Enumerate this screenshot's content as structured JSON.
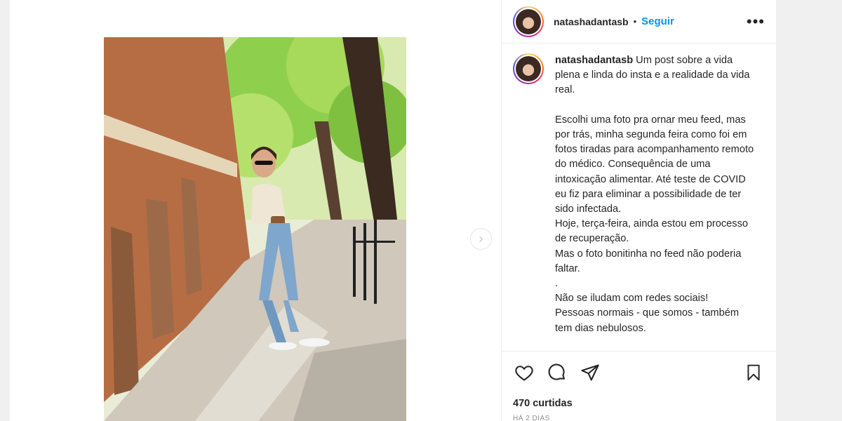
{
  "post": {
    "username": "natashadantasb",
    "separator": "•",
    "follow_label": "Seguir",
    "more_icon": "more-options-icon",
    "caption": "Um post sobre a vida plena e linda do insta e a realidade da vida real.\n\nEscolhi uma foto pra ornar meu feed, mas por trás, minha segunda feira como foi em fotos tiradas para acompanhamento remoto do médico. Consequência de uma intoxicação alimentar. Até teste de COVID eu fiz para eliminar a possibilidade de ter sido infectada.\nHoje, terça-feira, ainda estou em processo de recuperação.\nMas o foto bonitinha no feed não poderia faltar.\n.\nNão se iludam com redes sociais!\nPessoas normais - que somos - também tem dias nebulosos.",
    "likes": "470 curtidas",
    "timestamp": "HÁ 2 DIAS"
  },
  "icons": {
    "like": "heart-icon",
    "comment": "comment-icon",
    "share": "send-icon",
    "save": "bookmark-icon",
    "next": "chevron-right-icon"
  },
  "colors": {
    "follow": "#0095f6",
    "text": "#262626",
    "muted": "#8e8e8e",
    "border": "#efefef"
  }
}
